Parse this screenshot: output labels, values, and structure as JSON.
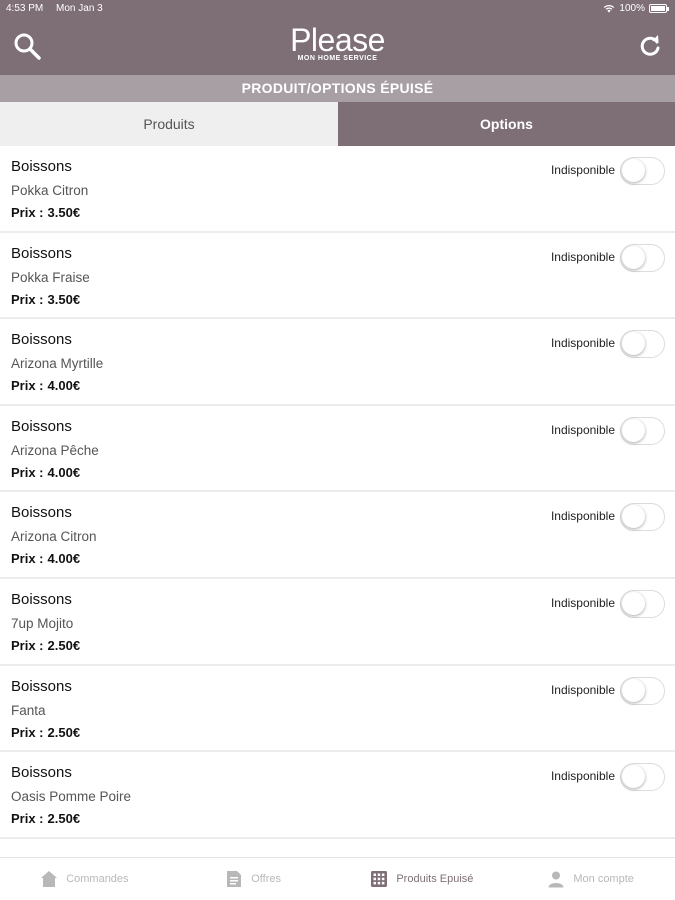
{
  "status_bar": {
    "time": "4:53 PM",
    "date": "Mon Jan 3",
    "battery": "100%"
  },
  "header": {
    "logo": "Please",
    "tagline": "MON HOME SERVICE"
  },
  "section_title": "PRODUIT/OPTIONS ÉPUISÉ",
  "tabs": {
    "products": "Produits",
    "options": "Options"
  },
  "price_label": "Prix :",
  "status_label": "Indisponible",
  "items": [
    {
      "category": "Boissons",
      "name": "Pokka Citron",
      "price": "3.50€"
    },
    {
      "category": "Boissons",
      "name": "Pokka Fraise",
      "price": "3.50€"
    },
    {
      "category": "Boissons",
      "name": "Arizona Myrtille",
      "price": "4.00€"
    },
    {
      "category": "Boissons",
      "name": "Arizona Pêche",
      "price": "4.00€"
    },
    {
      "category": "Boissons",
      "name": "Arizona Citron",
      "price": "4.00€"
    },
    {
      "category": "Boissons",
      "name": "7up Mojito",
      "price": "2.50€"
    },
    {
      "category": "Boissons",
      "name": "Fanta",
      "price": "2.50€"
    },
    {
      "category": "Boissons",
      "name": "Oasis Pomme Poire",
      "price": "2.50€"
    }
  ],
  "bottom_nav": {
    "orders": "Commandes",
    "offers": "Offres",
    "sold_out": "Produits Epuisé",
    "account": "Mon compte"
  },
  "colors": {
    "brand": "#7e6f77",
    "section_bar": "#a89fa4",
    "inactive_tab": "#efefef"
  }
}
